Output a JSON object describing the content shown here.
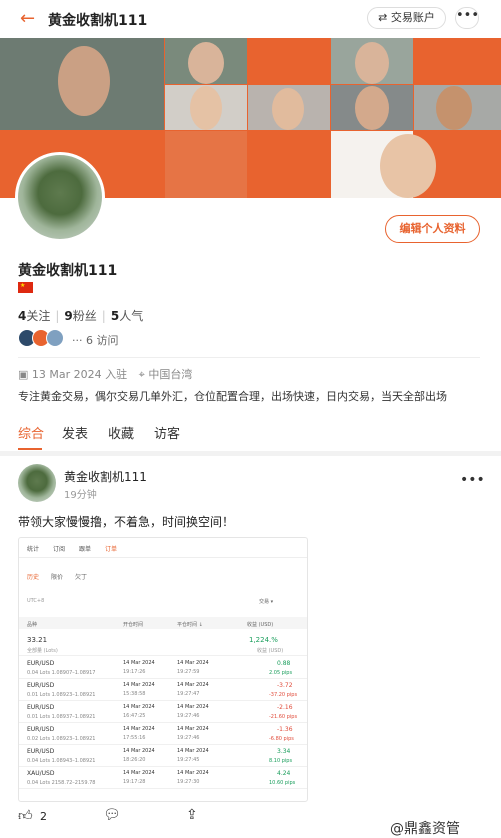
{
  "header": {
    "back_icon": "←",
    "title": "黄金收割机111",
    "trade_label": "⇄ 交易账户",
    "more_label": "•••"
  },
  "profile": {
    "name": "黄金收割机111",
    "edit_label": "编辑个人资料",
    "stats": {
      "follow_count": "4",
      "follow_label": "关注",
      "fans_count": "9",
      "fans_label": "粉丝",
      "pop_count": "5",
      "pop_label": "人气"
    },
    "visits": "···  6 访问",
    "joined": "13 Mar 2024 入驻",
    "location": "中国台湾",
    "bio": "专注黄金交易，偶尔交易几单外汇，仓位配置合理，出场快速，日内交易，当天全部出场"
  },
  "tabs": [
    "综合",
    "发表",
    "收藏",
    "访客"
  ],
  "post": {
    "author": "黄金收割机111",
    "time": "19分钟",
    "text": "带领大家慢慢撸，不着急，时间换空间！",
    "likes": "2",
    "screenshot": {
      "tabs": [
        "统计",
        "订阅",
        "跟单",
        "订单"
      ],
      "subtabs": [
        "历史",
        "限价",
        "欠丁"
      ],
      "filter": "UTC+8",
      "sort": "交易 ▾",
      "headers": [
        "品种",
        "开仓时间",
        "平仓时间 ↓",
        "收益 (USD)"
      ],
      "summary": {
        "total": "33.21",
        "total_label": "全部量 (Lots)",
        "profit": "1,224.%",
        "profit_label": "收益 (USD)"
      },
      "rows": [
        {
          "sym": "EUR/USD",
          "lots": "0.04 Lots 1.08907–1.08917",
          "open": "14 Mar 2024",
          "open_t": "19:17:26",
          "close": "14 Mar 2024",
          "close_t": "19:27:59",
          "pnl": "0.88",
          "pips": "2.05 pips",
          "pos": true
        },
        {
          "sym": "EUR/USD",
          "lots": "0.01 Lots 1.08923–1.08921",
          "open": "14 Mar 2024",
          "open_t": "15:38:58",
          "close": "14 Mar 2024",
          "close_t": "19:27:47",
          "pnl": "-3.72",
          "pips": "-37.20 pips",
          "pos": false
        },
        {
          "sym": "EUR/USD",
          "lots": "0.01 Lots 1.08937–1.08921",
          "open": "14 Mar 2024",
          "open_t": "16:47:25",
          "close": "14 Mar 2024",
          "close_t": "19:27:46",
          "pnl": "-2.16",
          "pips": "-21.60 pips",
          "pos": false
        },
        {
          "sym": "EUR/USD",
          "lots": "0.02 Lots 1.08923–1.08921",
          "open": "14 Mar 2024",
          "open_t": "17:55:16",
          "close": "14 Mar 2024",
          "close_t": "19:27:46",
          "pnl": "-1.36",
          "pips": "-6.80 pips",
          "pos": false
        },
        {
          "sym": "EUR/USD",
          "lots": "0.04 Lots 1.08943–1.08921",
          "open": "14 Mar 2024",
          "open_t": "18:26:20",
          "close": "14 Mar 2024",
          "close_t": "19:27:45",
          "pnl": "3.34",
          "pips": "8.10 pips",
          "pos": true
        },
        {
          "sym": "XAU/USD",
          "lots": "0.04 Lots 2158.72–2159.78",
          "open": "14 Mar 2024",
          "open_t": "19:17:28",
          "close": "14 Mar 2024",
          "close_t": "19:27:30",
          "pnl": "4.24",
          "pips": "10.60 pips",
          "pos": true
        }
      ]
    }
  },
  "watermark": "@鼎鑫资管",
  "colors": {
    "accent": "#e8632f"
  }
}
